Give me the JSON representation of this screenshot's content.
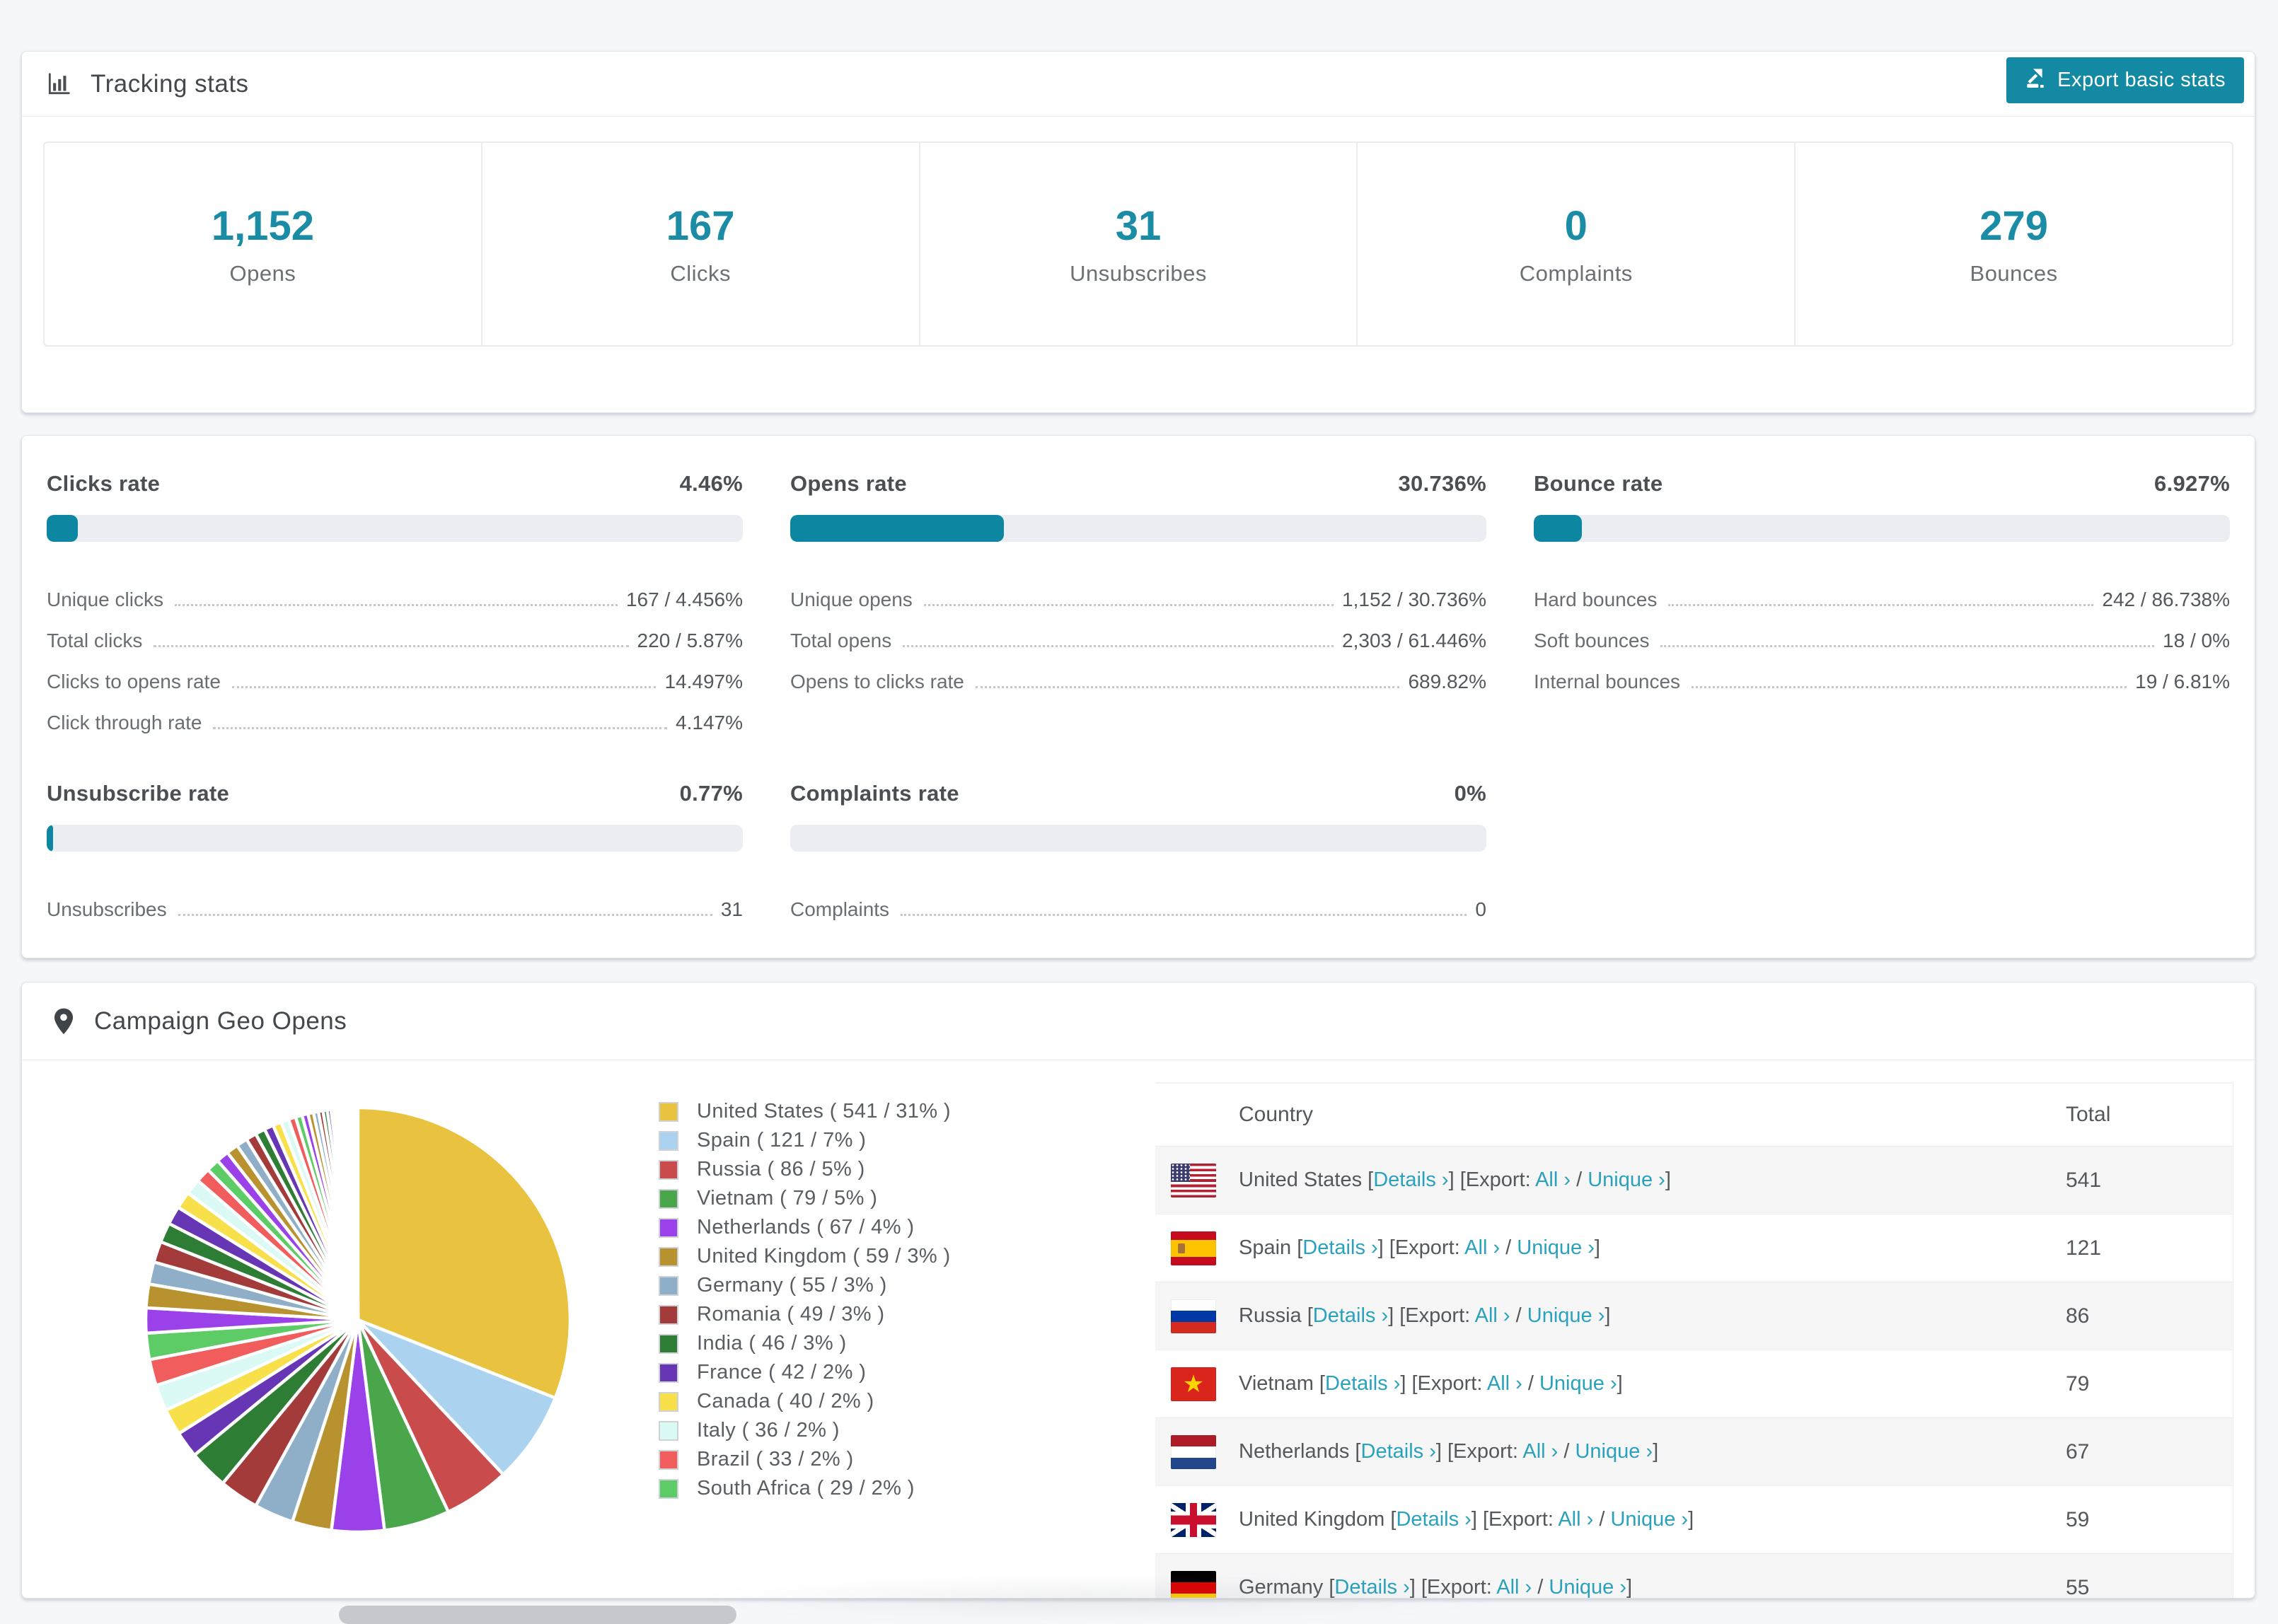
{
  "accent_color": "#0d87a1",
  "link_color": "#2aa1bd",
  "tracking": {
    "title": "Tracking stats",
    "export_button": "Export basic stats",
    "stats": [
      {
        "value": "1,152",
        "label": "Opens"
      },
      {
        "value": "167",
        "label": "Clicks"
      },
      {
        "value": "31",
        "label": "Unsubscribes"
      },
      {
        "value": "0",
        "label": "Complaints"
      },
      {
        "value": "279",
        "label": "Bounces"
      }
    ]
  },
  "rates": {
    "sections": [
      {
        "title": "Clicks rate",
        "value": "4.46%",
        "percent": 4.46,
        "rows": [
          {
            "label": "Unique clicks",
            "value": "167 / 4.456%"
          },
          {
            "label": "Total clicks",
            "value": "220 / 5.87%"
          },
          {
            "label": "Clicks to opens rate",
            "value": "14.497%"
          },
          {
            "label": "Click through rate",
            "value": "4.147%"
          }
        ]
      },
      {
        "title": "Opens rate",
        "value": "30.736%",
        "percent": 30.736,
        "rows": [
          {
            "label": "Unique opens",
            "value": "1,152 / 30.736%"
          },
          {
            "label": "Total opens",
            "value": "2,303 / 61.446%"
          },
          {
            "label": "Opens to clicks rate",
            "value": "689.82%"
          }
        ]
      },
      {
        "title": "Bounce rate",
        "value": "6.927%",
        "percent": 6.927,
        "rows": [
          {
            "label": "Hard bounces",
            "value": "242 / 86.738%"
          },
          {
            "label": "Soft bounces",
            "value": "18 / 0%"
          },
          {
            "label": "Internal bounces",
            "value": "19 / 6.81%"
          }
        ]
      },
      {
        "title": "Unsubscribe rate",
        "value": "0.77%",
        "percent": 0.77,
        "rows": [
          {
            "label": "Unsubscribes",
            "value": "31"
          }
        ]
      },
      {
        "title": "Complaints rate",
        "value": "0%",
        "percent": 0,
        "rows": [
          {
            "label": "Complaints",
            "value": "0"
          }
        ]
      }
    ]
  },
  "geo": {
    "title": "Campaign Geo Opens",
    "chart_data": {
      "type": "pie",
      "title": "Campaign Geo Opens",
      "legend_position": "right",
      "start_angle_deg": -90,
      "direction": "clockwise",
      "categories": [
        "United States",
        "Spain",
        "Russia",
        "Vietnam",
        "Netherlands",
        "United Kingdom",
        "Germany",
        "Romania",
        "India",
        "France",
        "Canada",
        "Italy",
        "Brazil",
        "South Africa"
      ],
      "values": [
        541,
        121,
        86,
        79,
        67,
        59,
        55,
        49,
        46,
        42,
        40,
        36,
        33,
        29
      ],
      "percents": [
        31,
        7,
        5,
        5,
        4,
        3,
        3,
        3,
        3,
        2,
        2,
        2,
        2,
        2
      ],
      "colors": [
        "#e9c23f",
        "#abd3f0",
        "#c94b4b",
        "#4aa64a",
        "#9a41e9",
        "#b8922e",
        "#8fafc9",
        "#a43b3b",
        "#2e7d34",
        "#6736b5",
        "#f8e04a",
        "#dbfaf6",
        "#f15d5d",
        "#5ecc66"
      ],
      "others_note": "remaining ~26% is many small unlabeled country slices, estimated",
      "others_slices": [
        1.9,
        1.8,
        1.7,
        1.6,
        1.5,
        1.4,
        1.3,
        1.2,
        1.1,
        1.0,
        0.95,
        0.9,
        0.85,
        0.8,
        0.75,
        0.7,
        0.65,
        0.6,
        0.55,
        0.5,
        0.46,
        0.42,
        0.38,
        0.35,
        0.32,
        0.29,
        0.26,
        0.23,
        0.2,
        0.18,
        0.16,
        0.14,
        0.12,
        0.1,
        0.09,
        0.08,
        0.07,
        0.06,
        0.05,
        0.045,
        0.04,
        0.035,
        0.03,
        0.025,
        0.02
      ]
    },
    "legend_format": "{name} ( {value} / {pct}% )",
    "table": {
      "headers": [
        "Country",
        "Total"
      ],
      "link_labels": {
        "details": "Details ›",
        "export": "Export:",
        "all": "All ›",
        "unique": "Unique ›"
      },
      "rows": [
        {
          "country": "United States",
          "flag": "us",
          "total": "541"
        },
        {
          "country": "Spain",
          "flag": "es",
          "total": "121"
        },
        {
          "country": "Russia",
          "flag": "ru",
          "total": "86"
        },
        {
          "country": "Vietnam",
          "flag": "vn",
          "total": "79"
        },
        {
          "country": "Netherlands",
          "flag": "nl",
          "total": "67"
        },
        {
          "country": "United Kingdom",
          "flag": "gb",
          "total": "59"
        },
        {
          "country": "Germany",
          "flag": "de",
          "total": "55"
        }
      ]
    }
  }
}
